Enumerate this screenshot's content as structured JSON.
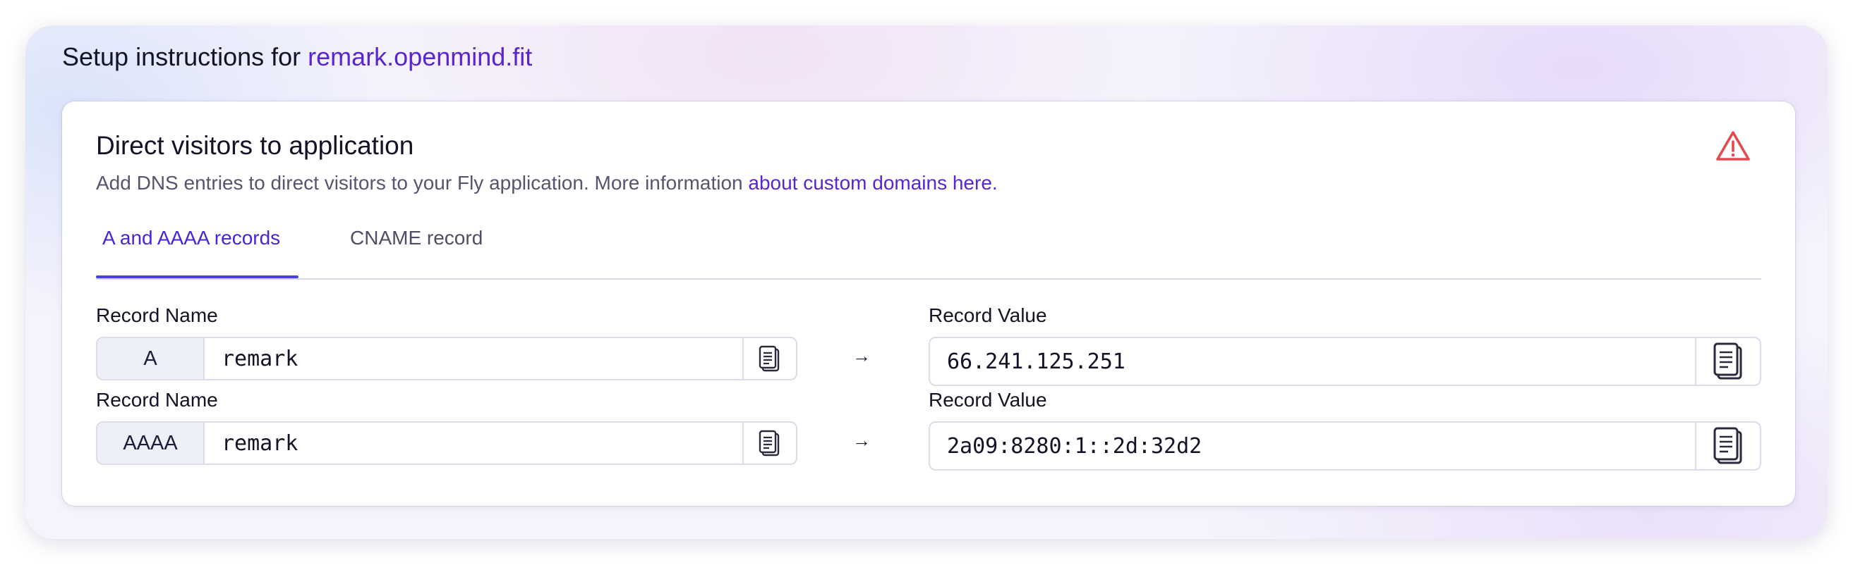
{
  "heading": {
    "prefix": "Setup instructions for ",
    "domain": "remark.openmind.fit"
  },
  "card": {
    "title": "Direct visitors to application",
    "description": "Add DNS entries to direct visitors to your Fly application. More information ",
    "link": "about custom domains here.",
    "status_icon": "warning-triangle-icon",
    "status_color": "#e5484d"
  },
  "tabs": [
    {
      "label": "A and AAAA records",
      "active": true
    },
    {
      "label": "CNAME record",
      "active": false
    }
  ],
  "records": [
    {
      "name_label": "Record Name",
      "type": "A",
      "name": "remark",
      "value_label": "Record Value",
      "value": "66.241.125.251"
    },
    {
      "name_label": "Record Name",
      "type": "AAAA",
      "name": "remark",
      "value_label": "Record Value",
      "value": "2a09:8280:1::2d:32d2"
    }
  ],
  "arrow_glyph": "→",
  "colors": {
    "accent": "#5a24cf",
    "tab_active": "#4b3fe0",
    "warning": "#e5484d"
  }
}
